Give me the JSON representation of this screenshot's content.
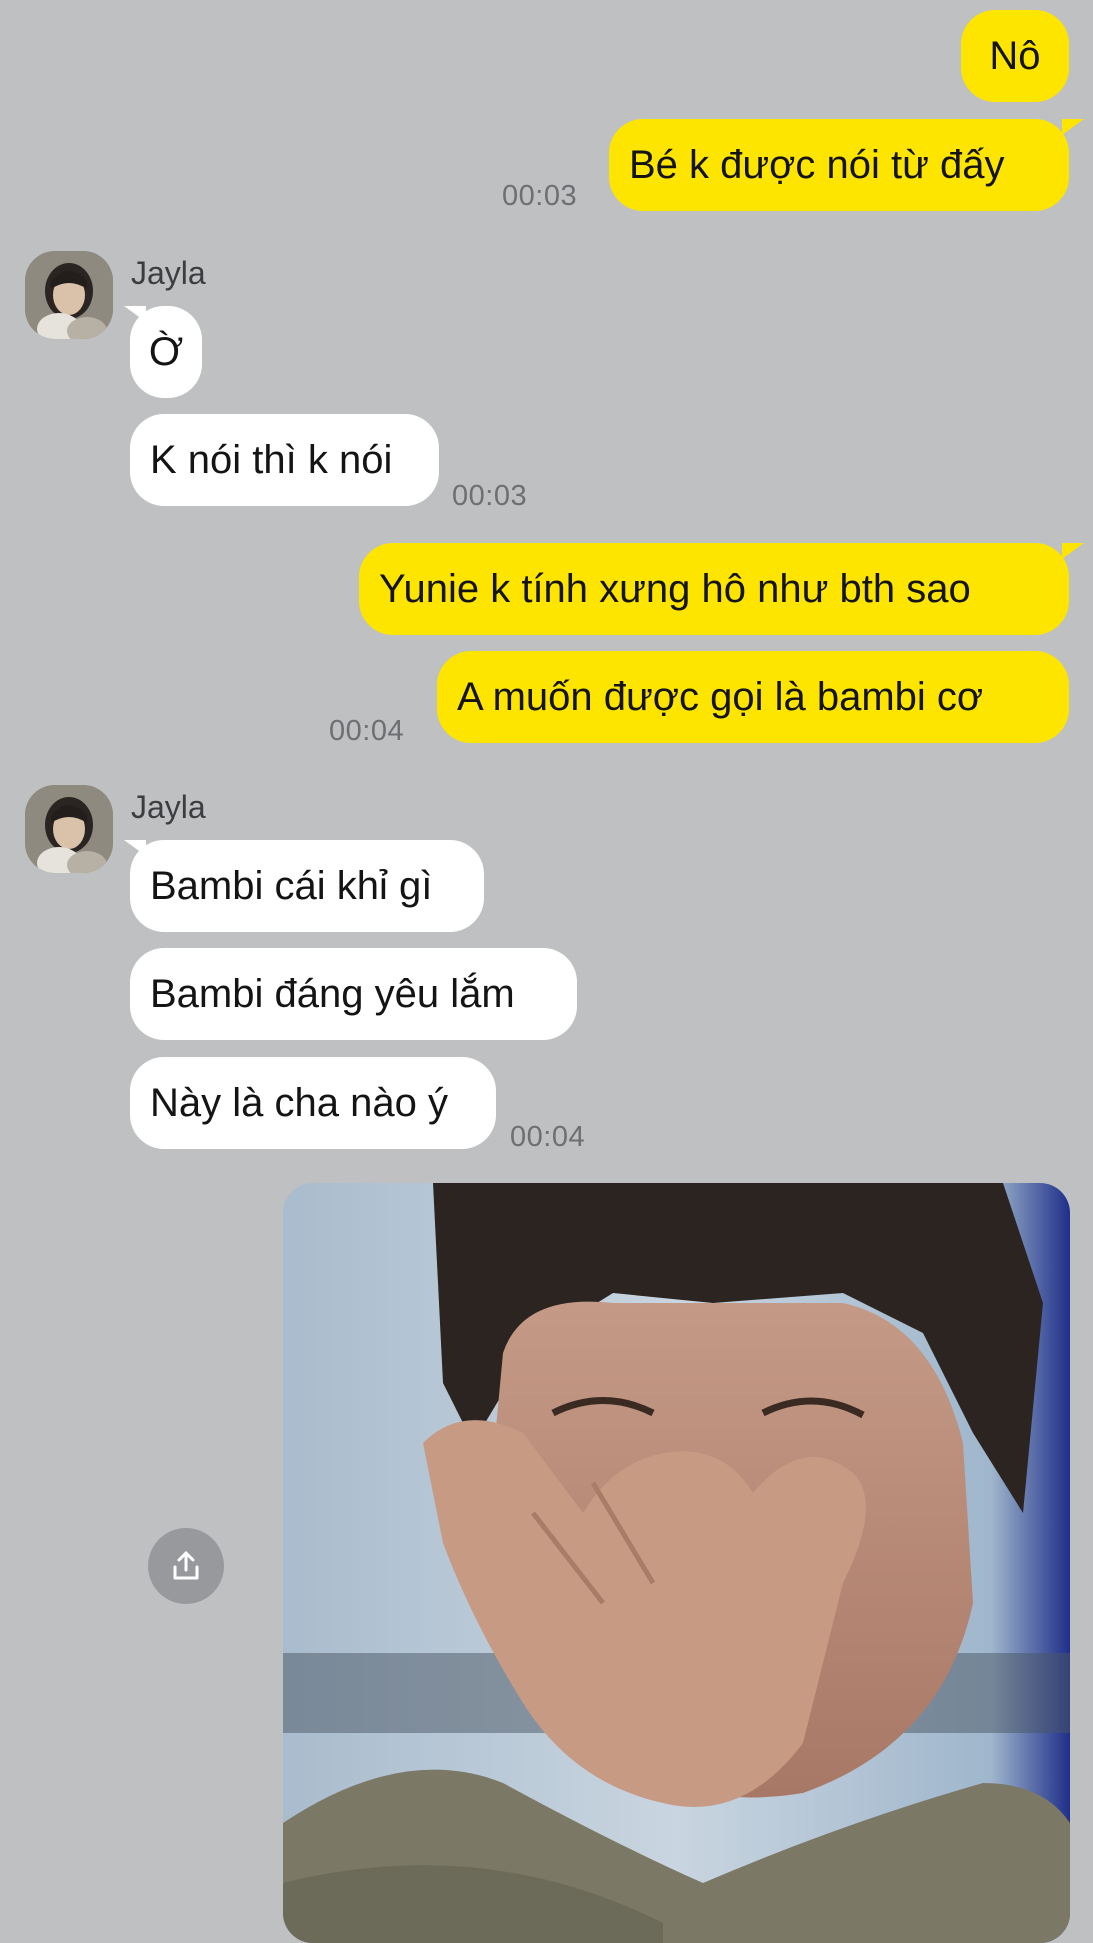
{
  "messages": {
    "m1": "Nô",
    "m2": "Bé k được nói từ đấy",
    "t1": "00:03",
    "sender1": "Jayla",
    "m3": "Ờ",
    "m4": "K nói thì k nói",
    "t2": "00:03",
    "m5": "Yunie k tính xưng hô như bth sao",
    "m6": "A muốn được gọi là bambi cơ",
    "t3": "00:04",
    "sender2": "Jayla",
    "m7": "Bambi cái khỉ gì",
    "m8": "Bambi đáng yêu lắm",
    "m9": "Này là cha nào ý",
    "t4": "00:04"
  },
  "icons": {
    "share": "share-upload-icon",
    "avatar": "profile-avatar"
  },
  "colors": {
    "background": "#bfc0c2",
    "outgoing_bubble": "#fde500",
    "incoming_bubble": "#ffffff"
  }
}
